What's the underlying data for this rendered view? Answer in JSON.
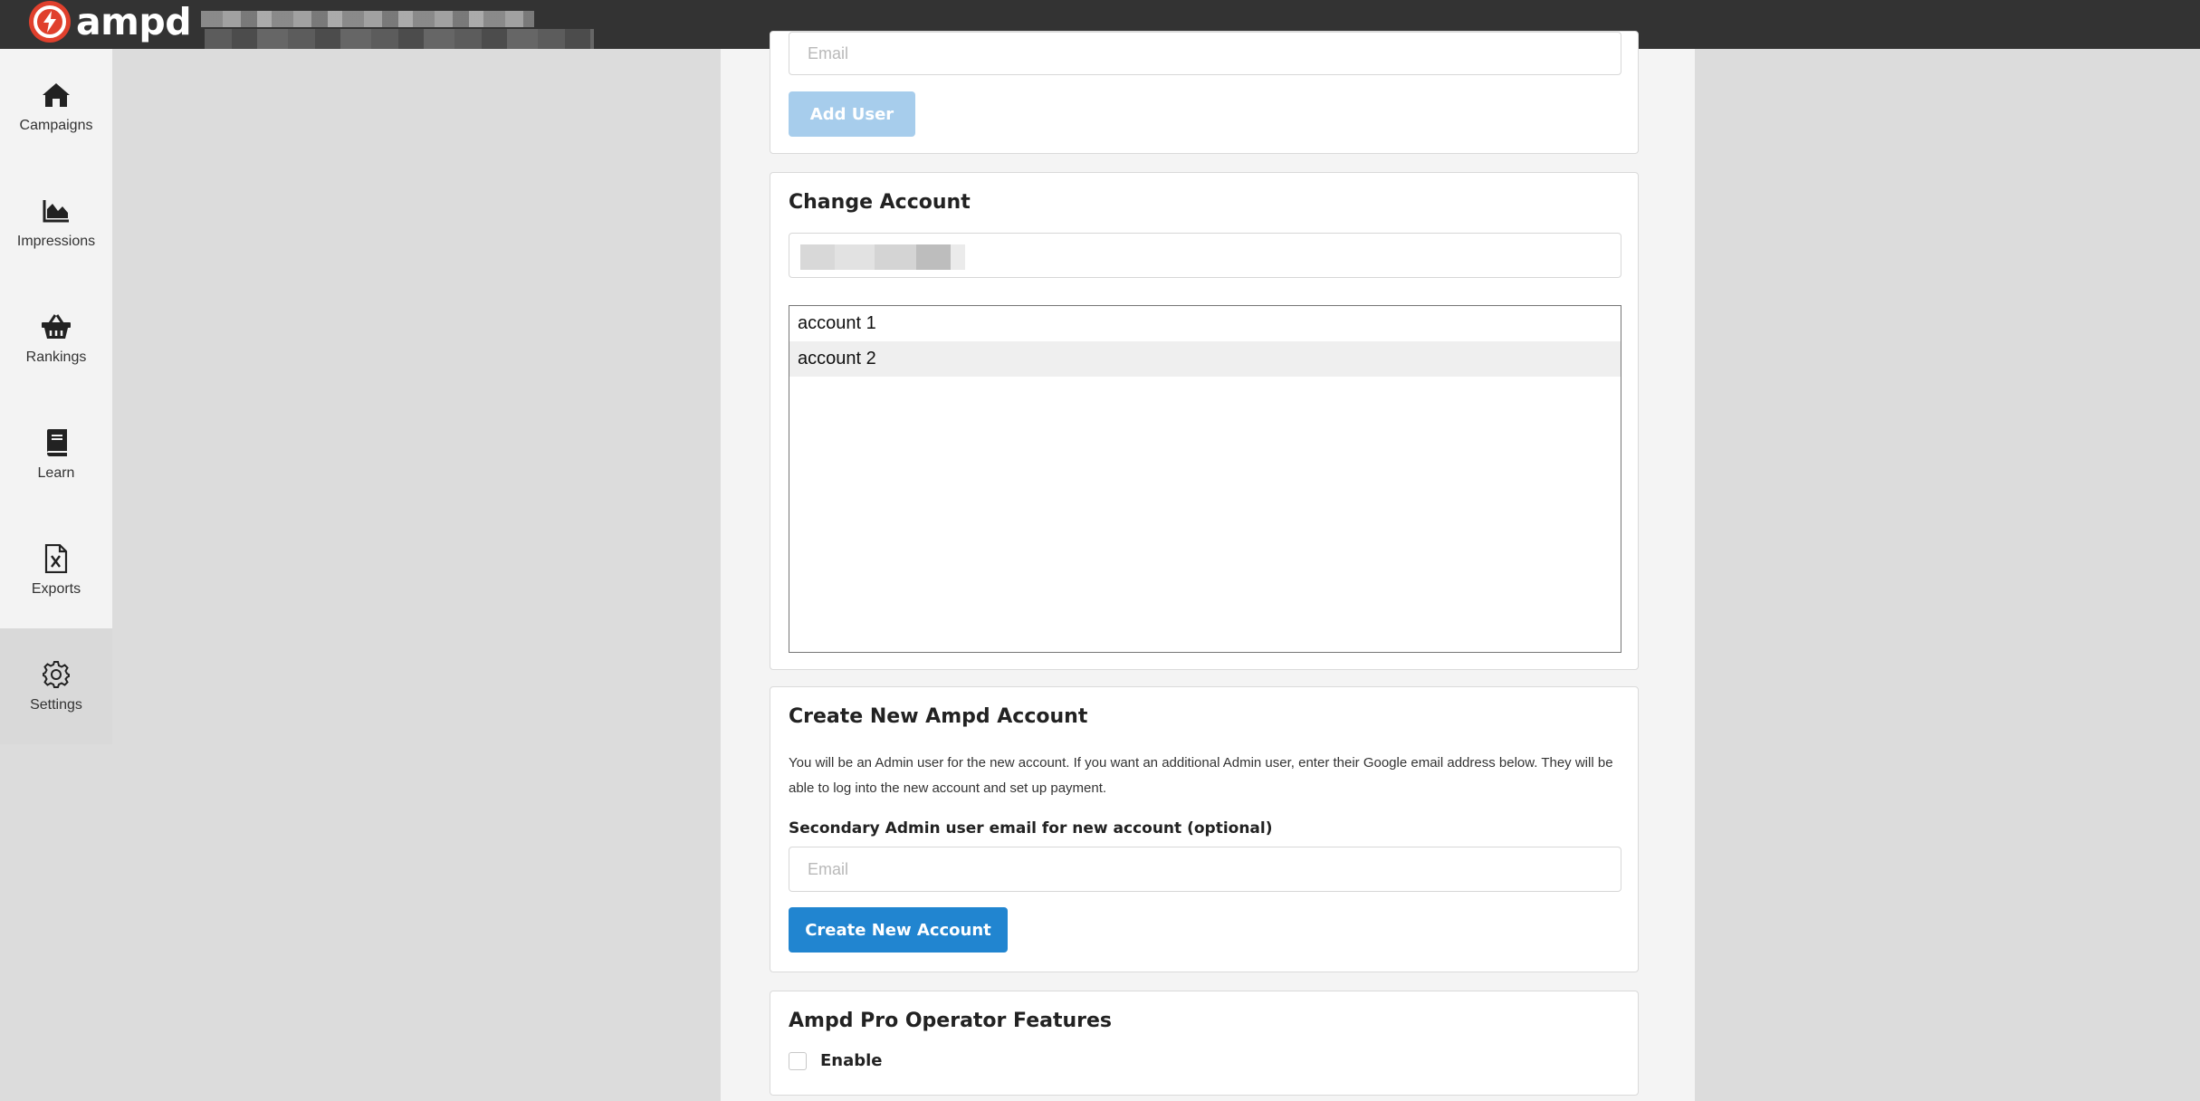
{
  "app": {
    "logo_text": "ampd"
  },
  "sidebar": {
    "items": [
      {
        "label": "Campaigns",
        "icon": "home-icon"
      },
      {
        "label": "Impressions",
        "icon": "area-chart-icon"
      },
      {
        "label": "Rankings",
        "icon": "basket-icon"
      },
      {
        "label": "Learn",
        "icon": "book-icon"
      },
      {
        "label": "Exports",
        "icon": "excel-file-icon"
      },
      {
        "label": "Settings",
        "icon": "gear-icon",
        "active": true
      }
    ]
  },
  "add_user": {
    "email_placeholder": "Email",
    "button_label": "Add User"
  },
  "change_account": {
    "title": "Change Account",
    "accounts": [
      "account 1",
      "account 2"
    ]
  },
  "create_account": {
    "title": "Create New Ampd Account",
    "description": "You will be an Admin user for the new account. If you want an additional Admin user, enter their Google email address below. They will be able to log into the new account and set up payment.",
    "email_label": "Secondary Admin user email for new account (optional)",
    "email_placeholder": "Email",
    "button_label": "Create New Account"
  },
  "pro_operator": {
    "title": "Ampd Pro Operator Features",
    "checkbox_label": "Enable"
  },
  "colors": {
    "topbar": "#333333",
    "brand_red": "#e0402d",
    "primary_button": "#2185d0",
    "disabled_button": "#a7cdec",
    "sidebar": "#f3f3f3",
    "sidebar_active": "#d9d9d9"
  }
}
